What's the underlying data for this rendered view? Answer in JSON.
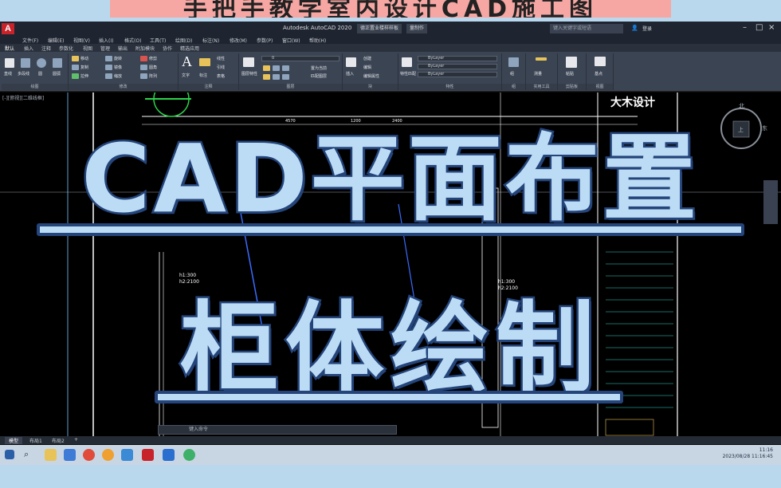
{
  "banner": {
    "text": "手把手教学室内设计CAD施工图"
  },
  "app": {
    "logo": "A",
    "title": "Autodesk AutoCAD 2020",
    "file_tabs": [
      "德正置业楼样样板",
      "量制作"
    ],
    "search_placeholder": "键入关键字或短语",
    "user": "登录",
    "menus": [
      "文件(F)",
      "编辑(E)",
      "视图(V)",
      "插入(I)",
      "格式(O)",
      "工具(T)",
      "绘图(D)",
      "标注(N)",
      "修改(M)",
      "参数(P)",
      "窗口(W)",
      "帮助(H)"
    ],
    "ribbon_tabs": [
      "默认",
      "插入",
      "注释",
      "参数化",
      "视图",
      "管理",
      "输出",
      "附加模块",
      "协作",
      "精选应用"
    ],
    "ribbon_groups": [
      "绘图",
      "修改",
      "注释",
      "图层",
      "块",
      "特性",
      "组",
      "实用工具",
      "剪贴板",
      "视图"
    ],
    "ribbon_labels": {
      "line": "直线",
      "polyline": "多段线",
      "circle": "圆",
      "arc": "圆弧",
      "move": "移动",
      "rotate": "旋转",
      "copy": "复制",
      "mirror": "镜像",
      "stretch": "拉伸",
      "scale": "缩放",
      "trim": "修剪",
      "fillet": "圆角",
      "array": "阵列",
      "text": "文字",
      "dimension": "标注",
      "linear": "线性",
      "leader": "引线",
      "table": "表格",
      "layer_props": "图层特性",
      "make_current": "置为当前",
      "match_layer": "匹配图层",
      "insert": "插入",
      "create": "创建",
      "edit": "编辑",
      "edit_attr": "编辑属性",
      "match_props": "特性匹配",
      "group": "组",
      "measure": "测量",
      "paste": "粘贴",
      "base": "基点"
    },
    "layer_current": "0",
    "bylayer": "ByLayer",
    "viewport_label": "[-][俯视][二维线框]",
    "cmd_placeholder": "键入命令",
    "layout_tabs": [
      "模型",
      "布局1",
      "布局2"
    ],
    "taskbar_time": "11:16",
    "taskbar_date": "2023/08/28 11:16:45"
  },
  "drawing": {
    "dims": [
      "4570",
      "1200",
      "2400"
    ],
    "h_labels_left": [
      "h1:300",
      "h2:2100"
    ],
    "h_labels_right": [
      "h1:300",
      "h2:2100"
    ],
    "compass": {
      "north": "北",
      "east": "东",
      "up": "上"
    },
    "watermark": "大木设计"
  },
  "overlay": {
    "title_line1": "CAD平面布置",
    "title_line2": "柜体绘制"
  },
  "colors": {
    "banner": "#f6a7a3",
    "title_fill": "#bcdcf6",
    "title_stroke": "#24447a",
    "autocad_red": "#c8222a"
  }
}
